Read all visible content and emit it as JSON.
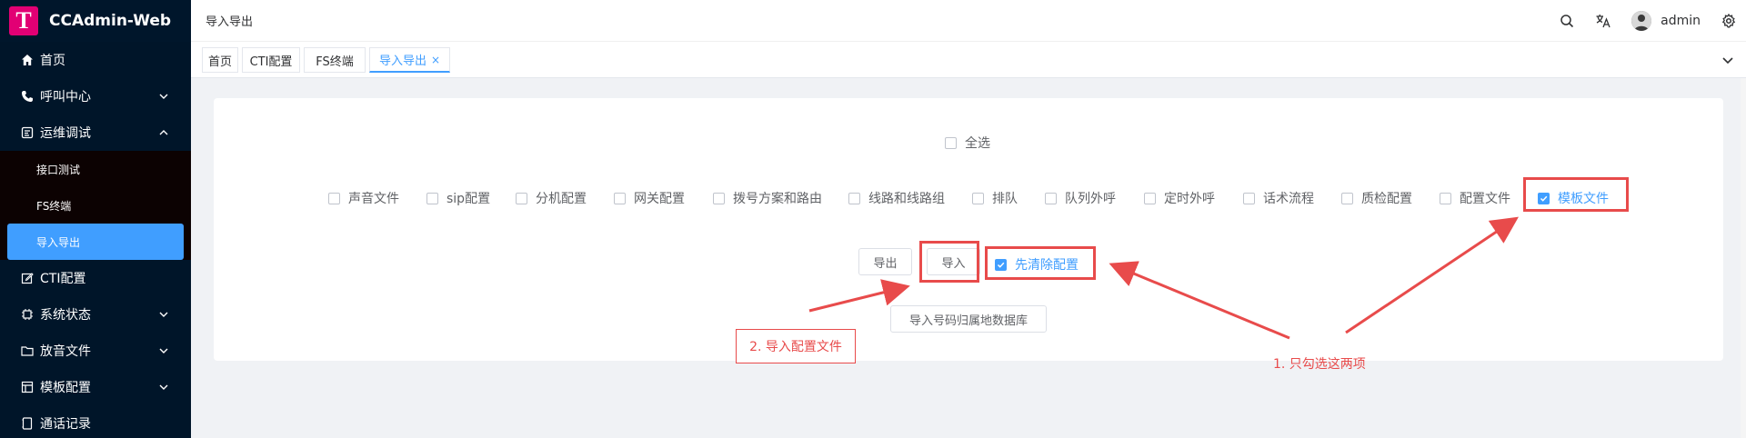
{
  "app": {
    "title": "CCAdmin-Web",
    "logo_letter": "T",
    "brand_color": "#e20074"
  },
  "sidebar": {
    "items": [
      {
        "label": "首页",
        "icon": "home-icon"
      },
      {
        "label": "呼叫中心",
        "icon": "phone-icon",
        "expandable": true
      },
      {
        "label": "运维调试",
        "icon": "debug-icon",
        "expandable": true,
        "expanded": true
      },
      {
        "label": "CTI配置",
        "icon": "edit-icon"
      },
      {
        "label": "系统状态",
        "icon": "chip-icon",
        "expandable": true
      },
      {
        "label": "放音文件",
        "icon": "folder-icon",
        "expandable": true
      },
      {
        "label": "模板配置",
        "icon": "template-icon",
        "expandable": true
      },
      {
        "label": "通话记录",
        "icon": "record-icon"
      }
    ],
    "submenu": [
      {
        "label": "接口测试"
      },
      {
        "label": "FS终端"
      },
      {
        "label": "导入导出",
        "active": true
      }
    ]
  },
  "header": {
    "breadcrumb": "导入导出",
    "username": "admin"
  },
  "tabs": [
    {
      "label": "首页"
    },
    {
      "label": "CTI配置"
    },
    {
      "label": "FS终端"
    },
    {
      "label": "导入导出",
      "active": true,
      "close": "×"
    }
  ],
  "content": {
    "select_all": {
      "label": "全选",
      "checked": false
    },
    "options": [
      {
        "label": "声音文件",
        "checked": false
      },
      {
        "label": "sip配置",
        "checked": false
      },
      {
        "label": "分机配置",
        "checked": false
      },
      {
        "label": "网关配置",
        "checked": false
      },
      {
        "label": "拨号方案和路由",
        "checked": false
      },
      {
        "label": "线路和线路组",
        "checked": false
      },
      {
        "label": "排队",
        "checked": false
      },
      {
        "label": "队列外呼",
        "checked": false
      },
      {
        "label": "定时外呼",
        "checked": false
      },
      {
        "label": "话术流程",
        "checked": false
      },
      {
        "label": "质检配置",
        "checked": false
      },
      {
        "label": "配置文件",
        "checked": false
      },
      {
        "label": "模板文件",
        "checked": true
      }
    ],
    "export_button": "导出",
    "import_button": "导入",
    "clear_config": {
      "label": "先清除配置",
      "checked": true
    },
    "import_db_button": "导入号码归属地数据库"
  },
  "annotations": {
    "step1": "1. 只勾选这两项",
    "step2": "2. 导入配置文件",
    "color": "#e84b4b"
  },
  "colors": {
    "primary": "#409eff",
    "sidebar_bg": "#001529"
  }
}
